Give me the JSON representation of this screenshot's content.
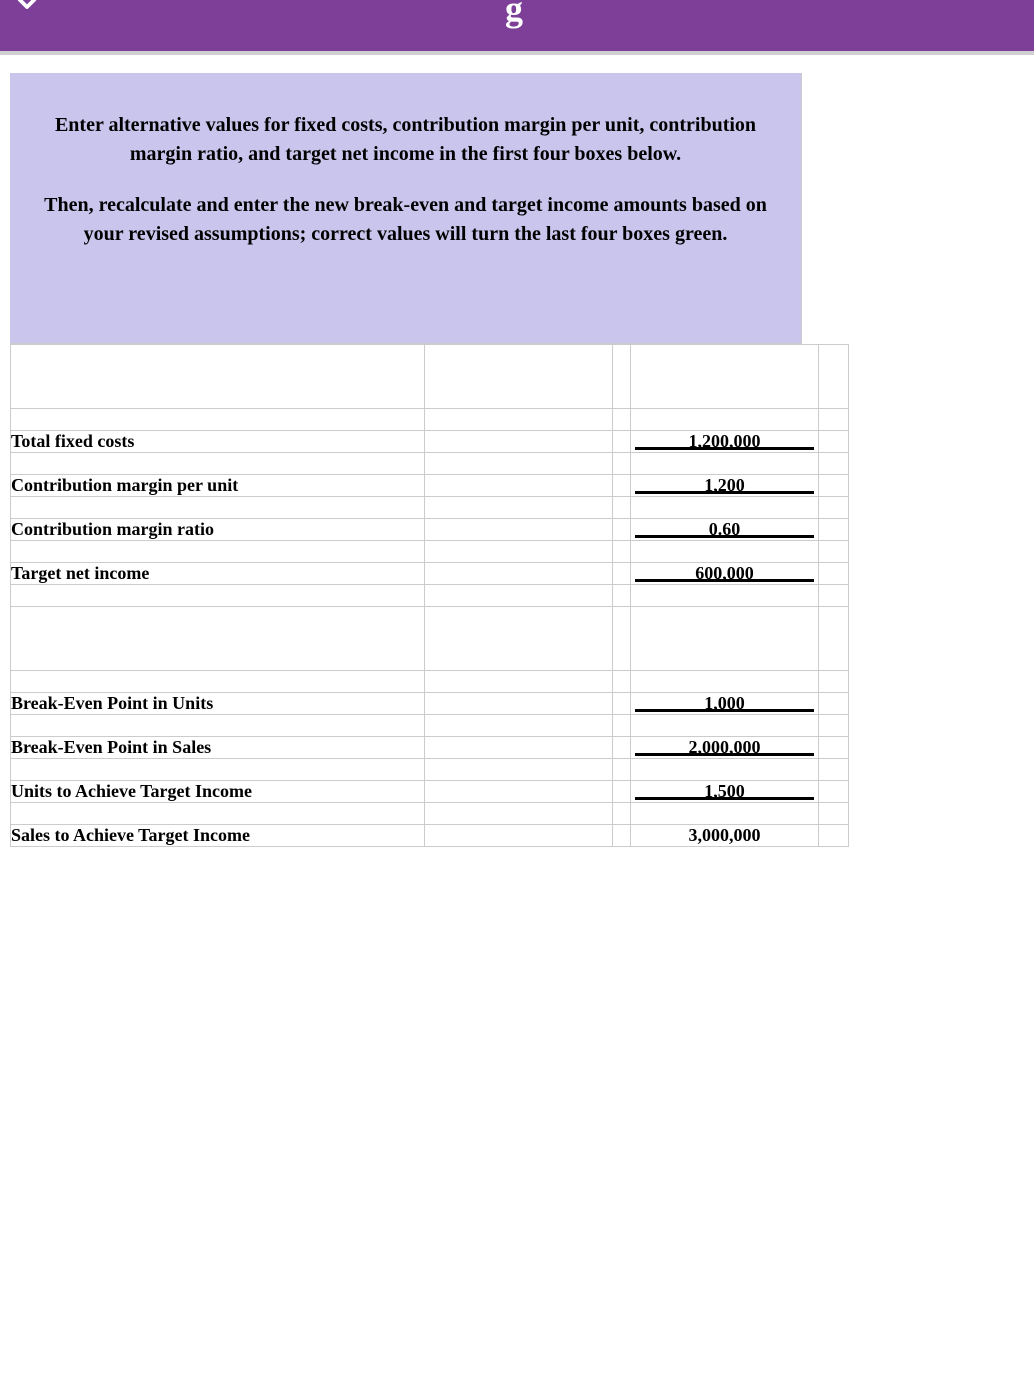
{
  "topbar": {
    "letter": "g"
  },
  "instructions": {
    "p1": "Enter alternative values for fixed costs, contribution margin per unit, contribution margin ratio, and target net income in the first four boxes below.",
    "p2": "Then, recalculate and enter the new break-even and target income amounts based on your revised assumptions; correct values will turn the last four boxes green."
  },
  "rows": {
    "total_fixed_costs": {
      "label": "Total fixed costs",
      "value": "1,200,000"
    },
    "cm_per_unit": {
      "label": "Contribution margin per unit",
      "value": "1,200"
    },
    "cm_ratio": {
      "label": "Contribution margin ratio",
      "value": "0.60"
    },
    "target_net_income": {
      "label": "Target net income",
      "value": "600,000"
    },
    "be_units": {
      "label": "Break-Even Point in Units",
      "value": "1,000"
    },
    "be_sales": {
      "label": "Break-Even Point in Sales",
      "value": "2,000,000"
    },
    "units_target": {
      "label": "Units to Achieve Target Income",
      "value": "1,500"
    },
    "sales_target": {
      "label": "Sales to Achieve Target Income",
      "value": "3,000,000"
    }
  }
}
